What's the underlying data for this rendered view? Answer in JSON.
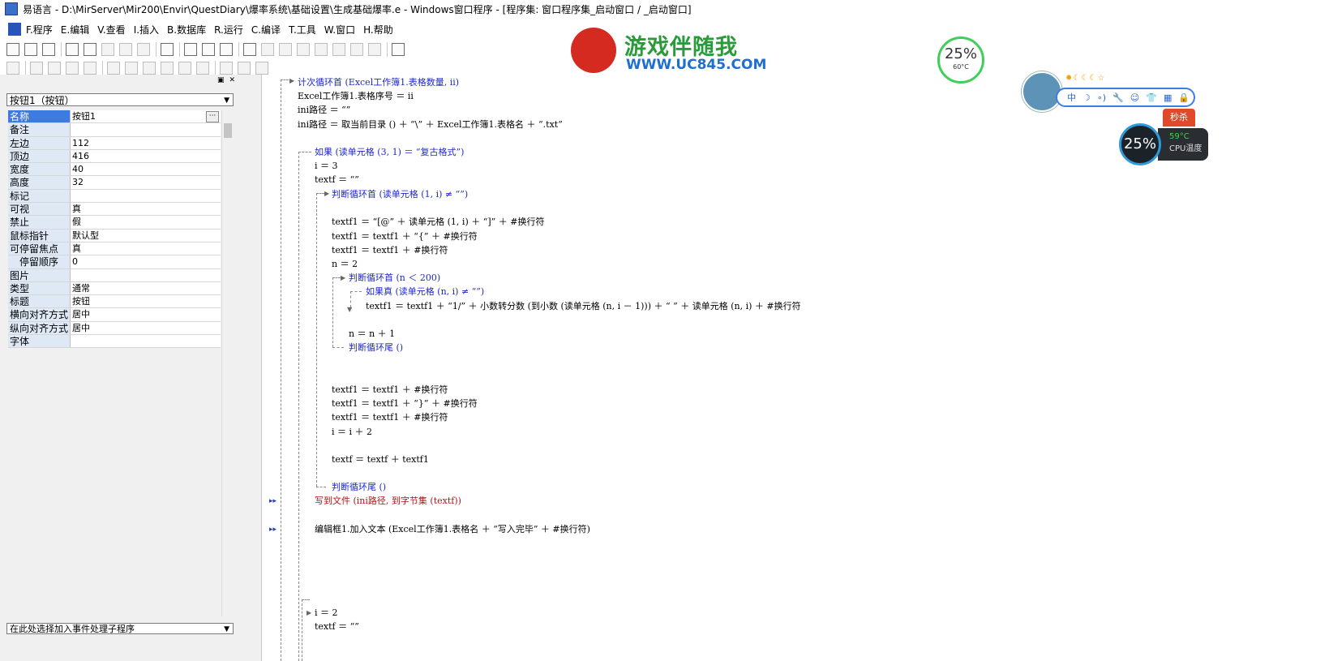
{
  "window": {
    "title": "易语言 - D:\\MirServer\\Mir200\\Envir\\QuestDiary\\爆率系统\\基础设置\\生成基础爆率.e - Windows窗口程序 - [程序集: 窗口程序集_启动窗口 / _启动窗口]"
  },
  "menu": {
    "items": [
      "F.程序",
      "E.编辑",
      "V.查看",
      "I.插入",
      "B.数据库",
      "R.运行",
      "C.编译",
      "T.工具",
      "W.窗口",
      "H.帮助"
    ]
  },
  "left_panel": {
    "component_select": "按钮1（按钮）",
    "properties": [
      {
        "key": "名称",
        "value": "按钮1"
      },
      {
        "key": "备注",
        "value": ""
      },
      {
        "key": "左边",
        "value": "112"
      },
      {
        "key": "顶边",
        "value": "416"
      },
      {
        "key": "宽度",
        "value": "40"
      },
      {
        "key": "高度",
        "value": "32"
      },
      {
        "key": "标记",
        "value": ""
      },
      {
        "key": "可视",
        "value": "真"
      },
      {
        "key": "禁止",
        "value": "假"
      },
      {
        "key": "鼠标指针",
        "value": "默认型"
      },
      {
        "key": "可停留焦点",
        "value": "真"
      },
      {
        "key": "　停留顺序",
        "value": "0"
      },
      {
        "key": "图片",
        "value": ""
      },
      {
        "key": "类型",
        "value": "通常"
      },
      {
        "key": "标题",
        "value": "按钮"
      },
      {
        "key": "横向对齐方式",
        "value": "居中"
      },
      {
        "key": "纵向对齐方式",
        "value": "居中"
      },
      {
        "key": "字体",
        "value": ""
      }
    ],
    "event_select": "在此处选择加入事件处理子程序"
  },
  "code": {
    "l01": "计次循环首 (Excel工作簿1.表格数量, ii)",
    "l02": "Excel工作簿1.表格序号 ＝ ii",
    "l03": "ini路径 ＝ “”",
    "l04": "ini路径 ＝ 取当前目录 () ＋ “\\” ＋ Excel工作簿1.表格名 ＋ “.txt”",
    "l05": "如果 (读单元格 (3, 1) ＝ “复古格式”)",
    "l06": "i ＝ 3",
    "l07": "textf ＝ “”",
    "l08": "判断循环首 (读单元格 (1, i) ≠ “”)",
    "l09": "textf1 ＝ “[@” ＋ 读单元格 (1, i) ＋ “]” ＋ #换行符",
    "l10": "textf1 ＝ textf1 ＋ “{” ＋ #换行符",
    "l11": "textf1 ＝ textf1 ＋ #换行符",
    "l12": "n ＝ 2",
    "l13": "判断循环首 (n ＜ 200)",
    "l14": "如果真 (读单元格 (n, i) ≠ “”)",
    "l15": "textf1 ＝ textf1 ＋ “1/” ＋ 小数转分数 (到小数 (读单元格 (n, i － 1))) ＋ “ ” ＋ 读单元格 (n, i) ＋ #换行符",
    "l16": "n ＝ n ＋ 1",
    "l17": "判断循环尾 ()",
    "l18": "textf1 ＝ textf1 ＋ #换行符",
    "l19": "textf1 ＝ textf1 ＋ “}” ＋ #换行符",
    "l20": "textf1 ＝ textf1 ＋ #换行符",
    "l21": "i ＝ i ＋ 2",
    "l22": "textf ＝ textf ＋ textf1",
    "l23": "判断循环尾 ()",
    "l24": "写到文件 (ini路径, 到字节集 (textf))",
    "l25": "编辑框1.加入文本 (Excel工作簿1.表格名 ＋ “写入完毕” ＋ #换行符)",
    "l26": "i ＝ 2",
    "l27": "textf ＝ “”"
  },
  "overlay": {
    "logo_name": "游戏伴随我",
    "logo_url": "WWW.UC845.COM",
    "gauge_pct": "25%",
    "gauge_temp": "60°C",
    "weather_bar": [
      "中",
      "☽",
      "∘)",
      "🔧",
      "☺",
      "👕",
      "▦",
      "🔒"
    ],
    "badge": "秒杀",
    "cpu_pct": "25%",
    "cpu_temp": "59°C",
    "cpu_label": "CPU温度"
  }
}
